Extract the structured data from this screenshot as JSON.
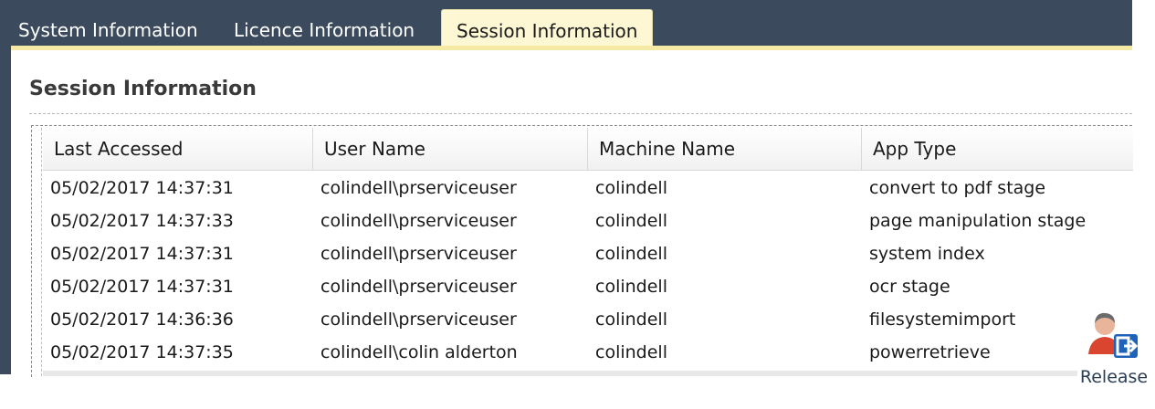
{
  "tabs": [
    {
      "label": "System Information",
      "active": false
    },
    {
      "label": "Licence Information",
      "active": false
    },
    {
      "label": "Session Information",
      "active": true
    }
  ],
  "section": {
    "title": "Session Information"
  },
  "table": {
    "columns": [
      "Last Accessed",
      "User Name",
      "Machine Name",
      "App Type"
    ],
    "rows": [
      [
        "05/02/2017 14:37:31",
        "colindell\\prserviceuser",
        "colindell",
        "convert to pdf stage"
      ],
      [
        "05/02/2017 14:37:33",
        "colindell\\prserviceuser",
        "colindell",
        "page manipulation stage"
      ],
      [
        "05/02/2017 14:37:31",
        "colindell\\prserviceuser",
        "colindell",
        "system index"
      ],
      [
        "05/02/2017 14:37:31",
        "colindell\\prserviceuser",
        "colindell",
        "ocr stage"
      ],
      [
        "05/02/2017 14:36:36",
        "colindell\\prserviceuser",
        "colindell",
        "filesystemimport"
      ],
      [
        "05/02/2017 14:37:35",
        "colindell\\colin alderton",
        "colindell",
        "powerretrieve"
      ]
    ]
  },
  "actions": {
    "release_label": "Release",
    "release_icon": "user-release-icon"
  },
  "colors": {
    "header_bar": "#3b4a5c",
    "active_tab": "#fdf7d4",
    "accent_line": "#f6e9a4",
    "release_arrow": "#1e63b8"
  }
}
